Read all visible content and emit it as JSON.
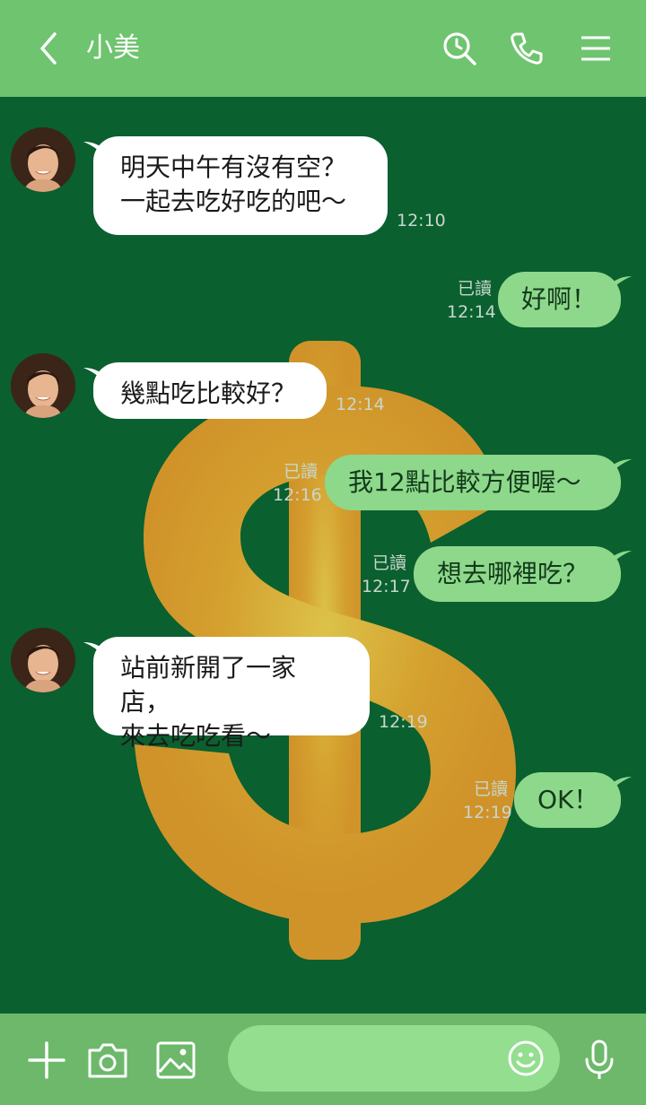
{
  "header": {
    "title": "小美",
    "back_icon": "chevron-left-icon",
    "search_icon": "search-icon",
    "call_icon": "phone-icon",
    "menu_icon": "menu-icon"
  },
  "messages": [
    {
      "side": "left",
      "text": "明天中午有沒有空？\n一起去吃好吃的吧～",
      "time": "12:10"
    },
    {
      "side": "right",
      "text": "好啊！",
      "read": "已讀",
      "time": "12:14"
    },
    {
      "side": "left",
      "text": "幾點吃比較好？",
      "time": "12:14"
    },
    {
      "side": "right",
      "text": "我12點比較方便喔～",
      "read": "已讀",
      "time": "12:16"
    },
    {
      "side": "right",
      "text": "想去哪裡吃？",
      "read": "已讀",
      "time": "12:17"
    },
    {
      "side": "left",
      "text": "站前新開了一家店，\n來去吃吃看～",
      "time": "12:19"
    },
    {
      "side": "right",
      "text": "OK！",
      "read": "已讀",
      "time": "12:19"
    }
  ],
  "footer": {
    "plus_icon": "plus-icon",
    "camera_icon": "camera-icon",
    "image_icon": "image-icon",
    "emoji_icon": "emoji-icon",
    "mic_icon": "microphone-icon",
    "input_value": ""
  },
  "colors": {
    "header": "#6fc46f",
    "background": "#0a602f",
    "bubble_right": "#8ed88b",
    "bubble_left": "#ffffff",
    "dollar": "#d4962a"
  }
}
